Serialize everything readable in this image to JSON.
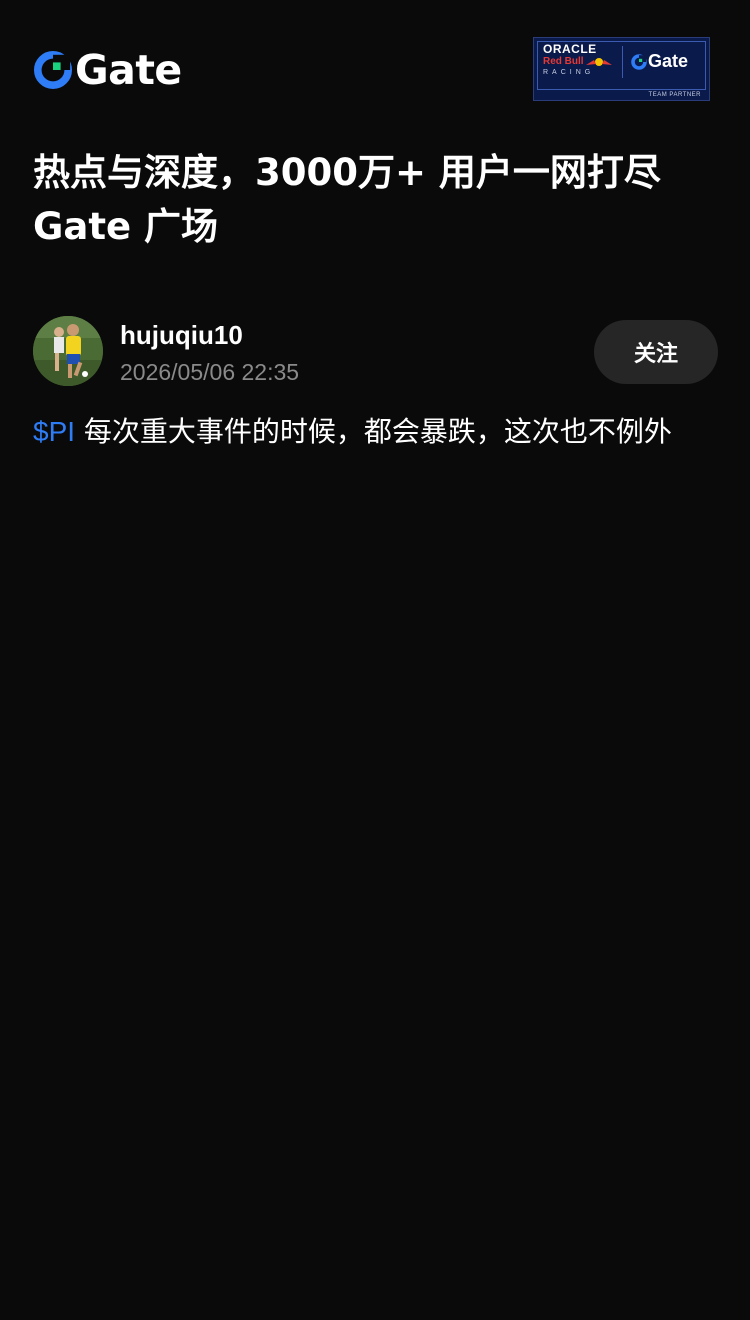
{
  "header": {
    "logo_text": "Gate",
    "partner_badge": {
      "oracle": "ORACLE",
      "red_bull": "Red Bull",
      "racing": "RACING",
      "gate": "Gate",
      "team_partner": "TEAM PARTNER"
    }
  },
  "headline": {
    "line1": "热点与深度，3000万+ 用户一网打尽",
    "line2": "Gate 广场"
  },
  "post": {
    "author": "hujuqiu10",
    "timestamp": "2026/05/06 22:35",
    "follow_label": "关注",
    "ticker": "$PI",
    "text": " 每次重大事件的时候，都会暴跌，这次也不例外"
  },
  "colors": {
    "background": "#0a0a0a",
    "accent_blue": "#2e7cf6",
    "logo_green": "#19d37e",
    "follow_button_bg": "#262626",
    "timestamp_gray": "#8a8a8a"
  },
  "icons": {
    "logo": "gate-logo-icon",
    "avatar": "user-avatar"
  }
}
